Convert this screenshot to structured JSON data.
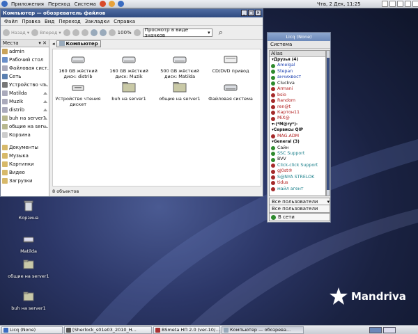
{
  "top_panel": {
    "menus": [
      "Приложения",
      "Переход",
      "Система"
    ],
    "clock": "Чтв, 2 Дек, 11:25"
  },
  "file_manager": {
    "title": "Компьютер — обозреватель файлов",
    "menu": [
      "Файл",
      "Правка",
      "Вид",
      "Переход",
      "Закладки",
      "Справка"
    ],
    "toolbar": {
      "back": "Назад",
      "forward": "Вперед",
      "zoom": "100%",
      "view_mode": "Просмотр в виде значков"
    },
    "places_title": "Места",
    "places": [
      {
        "label": "admin",
        "icon": "home-folder-icon",
        "eject": false
      },
      {
        "label": "Рабочий стол",
        "icon": "desktop-icon",
        "eject": false
      },
      {
        "label": "Файловая сист...",
        "icon": "drive-icon",
        "eject": false
      },
      {
        "label": "Сеть",
        "icon": "network-icon",
        "eject": false
      },
      {
        "label": "Устройство чт...",
        "icon": "floppy-icon",
        "eject": true
      },
      {
        "label": "Matilda",
        "icon": "drive-icon",
        "eject": true
      },
      {
        "label": "Muzik",
        "icon": "drive-icon",
        "eject": true
      },
      {
        "label": "distrib",
        "icon": "drive-icon",
        "eject": true
      },
      {
        "label": "buh на server1",
        "icon": "share-icon",
        "eject": true
      },
      {
        "label": "общие на serv...",
        "icon": "share-icon",
        "eject": true
      },
      {
        "label": "Корзина",
        "icon": "trash-icon",
        "eject": false
      }
    ],
    "bookmarks": [
      {
        "label": "Документы",
        "icon": "folder-icon"
      },
      {
        "label": "Музыка",
        "icon": "folder-icon"
      },
      {
        "label": "Картинки",
        "icon": "folder-icon"
      },
      {
        "label": "Видео",
        "icon": "folder-icon"
      },
      {
        "label": "Загрузки",
        "icon": "folder-icon"
      }
    ],
    "location": "Компьютер",
    "items": [
      {
        "label": "160 GB жёсткий диск: distrib",
        "icon": "hard-disk-icon"
      },
      {
        "label": "160 GB жёсткий диск: Muzik",
        "icon": "hard-disk-icon"
      },
      {
        "label": "500 GB жёсткий диск: Matilda",
        "icon": "hard-disk-icon"
      },
      {
        "label": "CD/DVD привод",
        "icon": "optical-drive-icon"
      },
      {
        "label": "Устройство чтения дискет",
        "icon": "floppy-drive-icon"
      },
      {
        "label": "buh на server1",
        "icon": "network-share-icon"
      },
      {
        "label": "общие на server1",
        "icon": "network-share-icon"
      },
      {
        "label": "Файловая система",
        "icon": "filesystem-icon"
      }
    ],
    "status": "8 объектов"
  },
  "licq": {
    "title": "Licq (None)",
    "menu": "Система",
    "list_header": "Alias",
    "rows": [
      {
        "type": "group",
        "text": "Друзья (4)"
      },
      {
        "type": "contact",
        "text": "Amelgal",
        "status": "online",
        "color": "#1a3fb0"
      },
      {
        "type": "contact",
        "text": "Stepan",
        "status": "online",
        "color": "#1a3fb0"
      },
      {
        "type": "contact",
        "text": "анчихвост",
        "status": "online",
        "color": "#1a3fb0"
      },
      {
        "type": "contact",
        "text": "Cluckva",
        "status": "online",
        "color": "#111111"
      },
      {
        "type": "contact",
        "text": "Armani",
        "status": "offline",
        "color": "#b01a1a"
      },
      {
        "type": "contact",
        "text": "bsio",
        "status": "offline",
        "color": "#b01a1a"
      },
      {
        "type": "contact",
        "text": "Random",
        "status": "offline",
        "color": "#b01a1a"
      },
      {
        "type": "contact",
        "text": "ren@t",
        "status": "offline",
        "color": "#b01a1a"
      },
      {
        "type": "contact",
        "text": "Картон11",
        "status": "offline",
        "color": "#b01a1a"
      },
      {
        "type": "contact",
        "text": "MiX@",
        "status": "offline",
        "color": "#b01a1a"
      },
      {
        "type": "group",
        "text": "-(*M@ry*)-"
      },
      {
        "type": "group",
        "text": "Сервисы QIP"
      },
      {
        "type": "contact",
        "text": "MAG.ADM",
        "status": "offline",
        "color": "#b01a1a"
      },
      {
        "type": "group",
        "text": "General (3)"
      },
      {
        "type": "contact",
        "text": "Сайн",
        "status": "online",
        "color": "#111111"
      },
      {
        "type": "contact",
        "text": "SSC Support",
        "status": "online",
        "color": "#1a7f8a"
      },
      {
        "type": "contact",
        "text": "BVV",
        "status": "online",
        "color": "#111111"
      },
      {
        "type": "contact",
        "text": "Click-click Support",
        "status": "offline",
        "color": "#1a7f8a"
      },
      {
        "type": "contact",
        "text": "gJ0st®",
        "status": "offline",
        "color": "#b01a1a"
      },
      {
        "type": "contact",
        "text": "S@NYA STRELOK",
        "status": "offline",
        "color": "#1a7f8a"
      },
      {
        "type": "contact",
        "text": "tidus",
        "status": "offline",
        "color": "#b01a1a"
      },
      {
        "type": "contact",
        "text": "майл агент",
        "status": "offline",
        "color": "#1a7f8a"
      }
    ],
    "group_combo": "Все пользователи",
    "group_combo2": "Все пользователи",
    "status": "В сети"
  },
  "desktop_icons": [
    {
      "label": "Корзина",
      "icon": "trash-icon"
    },
    {
      "label": "Matilda",
      "icon": "drive-icon"
    },
    {
      "label": "общие на server1",
      "icon": "network-share-icon"
    },
    {
      "label": "buh на server1",
      "icon": "network-share-icon"
    }
  ],
  "taskbar": [
    {
      "label": "Licq (None)",
      "active": false
    },
    {
      "label": "[Sherlock_s01e03_2010_H...",
      "active": false
    },
    {
      "label": "BSmeta НП 2.0 (ver-10/...",
      "active": false
    },
    {
      "label": "Компьютер — обозрева...",
      "active": true
    }
  ],
  "brand": "Mandriva",
  "colors": {
    "title_bar": "#2f4a80",
    "licq_title": "#6b88b9",
    "online": "#2e8a2e",
    "offline": "#a52a2a"
  }
}
